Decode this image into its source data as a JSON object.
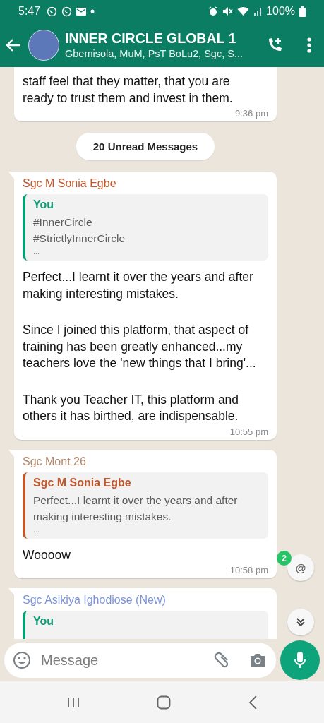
{
  "status_bar": {
    "time": "5:47",
    "battery": "100%"
  },
  "header": {
    "title": "INNER CIRCLE GLOBAL 1",
    "subtitle": "Gbemisola, MuM, PsT BoLu2, Sgc, S..."
  },
  "messages": [
    {
      "kind": "message",
      "paragraphs": [
        "staff feel that they matter, that you are",
        "ready to trust them and invest in them."
      ],
      "time": "9:36 pm"
    },
    {
      "kind": "divider",
      "text": "20 Unread Messages"
    },
    {
      "kind": "message",
      "sender": "Sgc M Sonia Egbe",
      "color": "#c0582e",
      "quote": {
        "author": "You",
        "color": "#0a9e74",
        "lines": [
          "#InnerCircle",
          "#StrictlyInnerCircle"
        ],
        "more": "..."
      },
      "paragraphs": [
        "Perfect...I learnt it over the years and after making interesting mistakes.",
        "Since I joined this platform, that aspect of training has been greatly enhanced...my teachers love the 'new things that I bring'...",
        "Thank you Teacher IT, this platform and others it has birthed, are indispensable."
      ],
      "time": "10:55 pm"
    },
    {
      "kind": "message",
      "sender": "Sgc Mont 26",
      "color": "#b5876a",
      "quote": {
        "author": "Sgc M Sonia Egbe",
        "color": "#c0582e",
        "lines": [
          "Perfect...I learnt it over the years and after making interesting mistakes."
        ],
        "more": "..."
      },
      "paragraphs": [
        "Woooow"
      ],
      "time": "10:58 pm"
    },
    {
      "kind": "message",
      "sender": "Sgc Asikiya Ighodiose (New)",
      "color": "#7b93dc",
      "quote": {
        "author": "You",
        "color": "#0a9e74"
      }
    }
  ],
  "mention_badge": "2",
  "mention_button": "@",
  "composer": {
    "placeholder": "Message"
  }
}
